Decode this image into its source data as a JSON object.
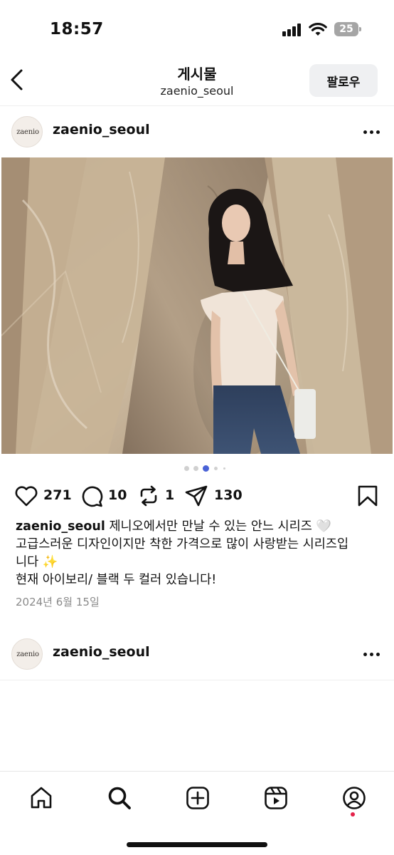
{
  "status_bar": {
    "time": "18:57",
    "battery_level": "25"
  },
  "header": {
    "title": "게시물",
    "subtitle": "zaenio_seoul",
    "follow_label": "팔로우"
  },
  "posts": [
    {
      "avatar_text": "zaenio",
      "username": "zaenio_seoul",
      "image_count": 5,
      "current_image": 3,
      "actions": {
        "likes": "271",
        "comments": "10",
        "reposts": "1",
        "shares": "130"
      },
      "caption": {
        "username": "zaenio_seoul",
        "line1": "제니오에서만 만날 수 있는 안느 시리즈 🤍",
        "line2": "고급스러운 디자인이지만 착한 가격으로 많이 사랑받는 시리즈입",
        "line3": "니다 ✨",
        "line4": "현재 아이보리/ 블랙 두 컬러 있습니다!"
      },
      "date": "2024년 6월 15일"
    },
    {
      "avatar_text": "zaenio",
      "username": "zaenio_seoul"
    }
  ],
  "tab_bar": {
    "items": [
      "home-icon",
      "search-icon",
      "create-icon",
      "reels-icon",
      "profile-icon"
    ],
    "notification_color": "#e4224a"
  },
  "colors": {
    "carousel_active_dot": "#4a62d6",
    "follow_button_bg": "#eff0f2"
  }
}
